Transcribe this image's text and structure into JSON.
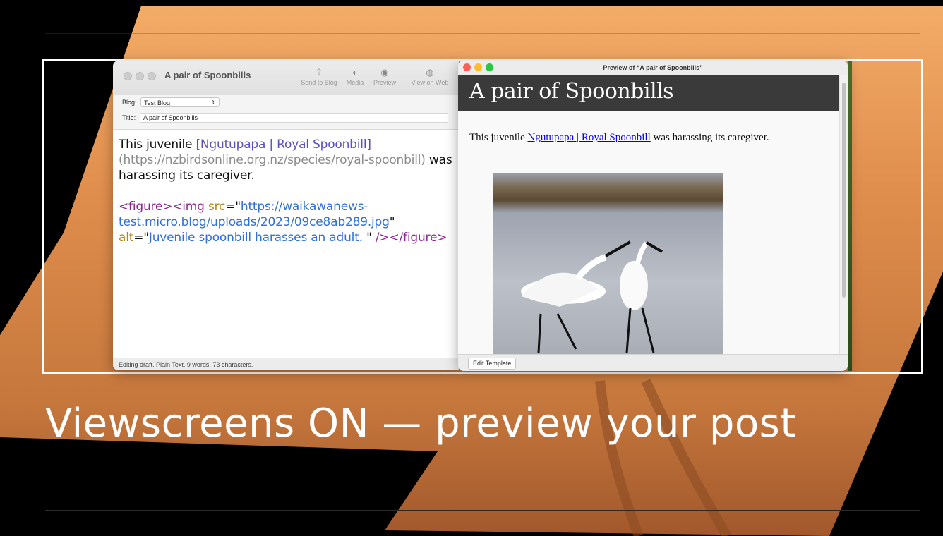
{
  "slide": {
    "heading": "Viewscreens ON — preview your post"
  },
  "editor": {
    "window_title": "A pair of Spoonbills",
    "toolbar": {
      "send_to_blog": "Send to Blog",
      "media": "Media",
      "preview": "Preview",
      "view_on_web": "View on Web"
    },
    "blog_label": "Blog:",
    "blog_value": "Test Blog",
    "title_label": "Title:",
    "title_value": "A pair of Spoonbills",
    "body": {
      "p1_text1": "This juvenile ",
      "p1_link_open": "[",
      "p1_link_text": "Ngutupapa | Royal Spoonbill",
      "p1_link_close": "]",
      "p1_url_open": "(",
      "p1_url": "https://nzbirdsonline.org.nz/species/royal-spoonbill",
      "p1_url_close": ")",
      "p1_text2": " was harassing its caregiver.",
      "p2_tag1": "<figure><img ",
      "p2_attr1": "src",
      "p2_eq1": "=\"",
      "p2_src": "https://waikawanews-test.micro.blog/uploads/2023/09ce8ab289.jpg",
      "p2_q1": "\" ",
      "p2_attr2": "alt",
      "p2_eq2": "=\"",
      "p2_alt": "Juvenile spoonbill harasses an adult. ",
      "p2_q2": "\" ",
      "p2_tag2": "/></figure>"
    },
    "status": "Editing draft. Plain Text. 9 words, 73 characters."
  },
  "preview": {
    "window_title": "Preview of “A pair of Spoonbills”",
    "post_title": "A pair of Spoonbills",
    "body_text1": "This juvenile ",
    "body_link": "Ngutupapa | Royal Spoonbill",
    "body_text2": " was harassing its caregiver.",
    "image_alt": "Juvenile spoonbill harasses an adult. ",
    "edit_template": "Edit Template"
  },
  "colors": {
    "mars_light": "#f0a862",
    "mars_dark": "#a85f2f",
    "traffic_red": "#fe5f57",
    "traffic_yellow": "#febc2e",
    "traffic_green": "#28c840",
    "link_blue": "#0000ee"
  }
}
